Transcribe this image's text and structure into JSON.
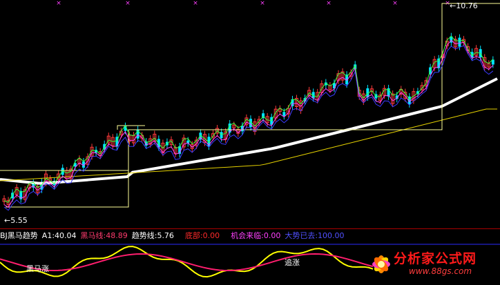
{
  "price_labels": {
    "high": "10.76",
    "low": "5.55"
  },
  "indicator": {
    "name": "BJ黑马趋势",
    "a1": "A1:40.04",
    "heima": "黑马线:48.89",
    "trend": "趋势线:5.76",
    "bottom": "底部:0.00",
    "chance": "机会来临:0.00",
    "rally": "大势已去:100.00"
  },
  "sub_labels": {
    "left": "黑马涨",
    "mid": "追涨"
  },
  "logo": {
    "title": "分析家公式网",
    "url": "www.88gs.com"
  },
  "colors": {
    "up": "#ff3b3b",
    "down": "#00e5ff",
    "heima": "#ff1e6e",
    "a1": "#ffffff",
    "trend": "#ffff00",
    "bottom": "#ff2a2a",
    "chance": "#ff40ff",
    "rally": "#4040ff",
    "ma_white": "#ffffff",
    "ma_yellow": "#e6d200"
  }
}
